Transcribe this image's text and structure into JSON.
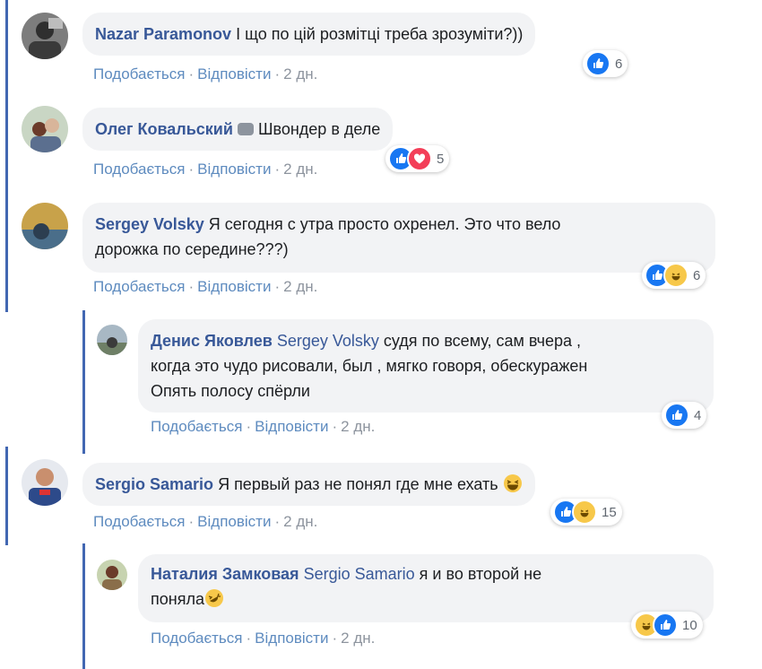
{
  "actions": {
    "like": "Подобається",
    "reply": "Відповісти",
    "sep": "·"
  },
  "comments": [
    {
      "author": "Nazar Paramonov",
      "text": "І що по цій розмітці треба зрозуміти?))",
      "time": "2 дн.",
      "reactions": [
        "like"
      ],
      "count": "6"
    },
    {
      "author": "Олег Ковальский",
      "text": "Швондер в деле",
      "time": "2 дн.",
      "reactions": [
        "like",
        "love"
      ],
      "count": "5"
    },
    {
      "author": "Sergey Volsky",
      "text_line1": "Я сегодня с утра просто охренел. Это что вело",
      "text_line2": "дорожка по середине???)",
      "time": "2 дн.",
      "reactions": [
        "like",
        "haha"
      ],
      "count": "6"
    },
    {
      "author": "Денис Яковлев",
      "mention": "Sergey Volsky",
      "text_line1": "судя по всему, сам вчера ,",
      "text_line2": "когда это чудо рисовали, был , мягко говоря, обескуражен",
      "text_line3": "Опять полосу спёрли",
      "time": "2 дн.",
      "reactions": [
        "like"
      ],
      "count": "4"
    },
    {
      "author": "Sergio Samario",
      "text": "Я первый раз не понял где мне ехать",
      "time": "2 дн.",
      "reactions": [
        "like",
        "haha"
      ],
      "count": "15"
    },
    {
      "author": "Наталия Замковая",
      "mention": "Sergio Samario",
      "text_line1": "я и во второй не",
      "text_line2": "поняла",
      "time": "2 дн.",
      "reactions": [
        "haha",
        "like"
      ],
      "count": "10"
    }
  ],
  "colors": {
    "thread_line": "#4267b2",
    "link": "#385898",
    "bubble": "#f2f3f5",
    "like": "#1877f2",
    "love": "#f33e58",
    "haha": "#f7c84a"
  }
}
